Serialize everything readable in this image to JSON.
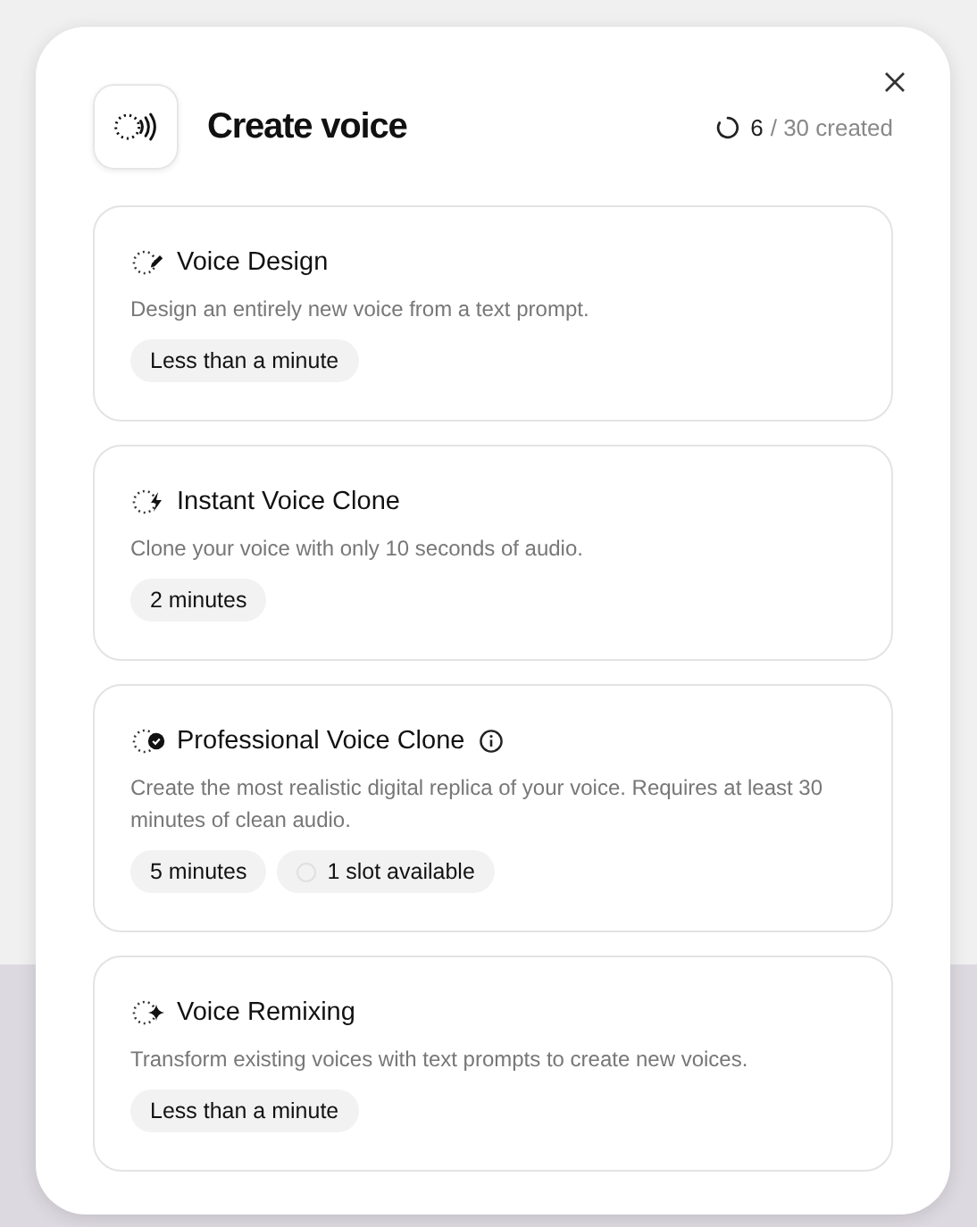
{
  "dialog": {
    "title": "Create voice",
    "quota": {
      "used": "6",
      "total": "/ 30 created"
    }
  },
  "options": [
    {
      "kind": "design",
      "title": "Voice Design",
      "info": false,
      "description": "Design an entirely new voice from a text prompt.",
      "tags": [
        {
          "kind": "time",
          "label": "Less than a minute"
        }
      ]
    },
    {
      "kind": "instant",
      "title": "Instant Voice Clone",
      "info": false,
      "description": "Clone your voice with only 10 seconds of audio.",
      "tags": [
        {
          "kind": "time",
          "label": "2 minutes"
        }
      ]
    },
    {
      "kind": "professional",
      "title": "Professional Voice Clone",
      "info": true,
      "description": "Create the most realistic digital replica of your voice. Requires at least 30 minutes of clean audio.",
      "tags": [
        {
          "kind": "time",
          "label": "5 minutes"
        },
        {
          "kind": "slots",
          "label": "1 slot available"
        }
      ]
    },
    {
      "kind": "remix",
      "title": "Voice Remixing",
      "info": false,
      "description": "Transform existing voices with text prompts to create new voices.",
      "tags": [
        {
          "kind": "time",
          "label": "Less than a minute"
        }
      ]
    }
  ]
}
